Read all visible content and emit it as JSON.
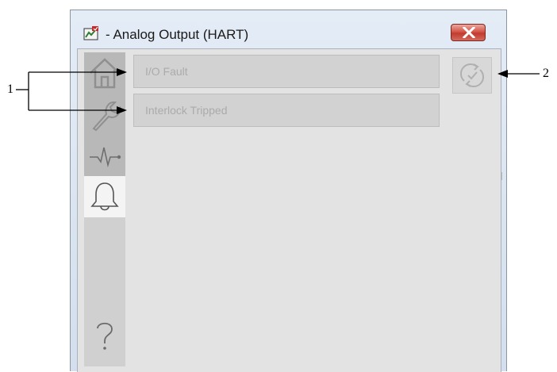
{
  "window": {
    "title": "- Analog Output (HART)",
    "close_icon": "close-x-icon"
  },
  "sidenav": {
    "items": [
      {
        "icon": "home-icon",
        "state": "disabled"
      },
      {
        "icon": "wrench-icon",
        "state": "disabled"
      },
      {
        "icon": "trend-icon",
        "state": "enabled"
      },
      {
        "icon": "bell-icon",
        "state": "active"
      },
      {
        "icon": "help-icon",
        "state": "enabled"
      }
    ]
  },
  "alarms": [
    {
      "label": "I/O Fault"
    },
    {
      "label": "Interlock Tripped"
    }
  ],
  "reset_button": {
    "icon": "reset-cycle-icon"
  },
  "callouts": {
    "left_number": "1",
    "right_number": "2"
  },
  "colors": {
    "window_frame": "#d3dfee",
    "close_button": "#c13b2e",
    "client_bg": "#e3e3e3",
    "alarm_bar_bg": "#d2d2d2",
    "alarm_text_disabled": "#ababab"
  }
}
